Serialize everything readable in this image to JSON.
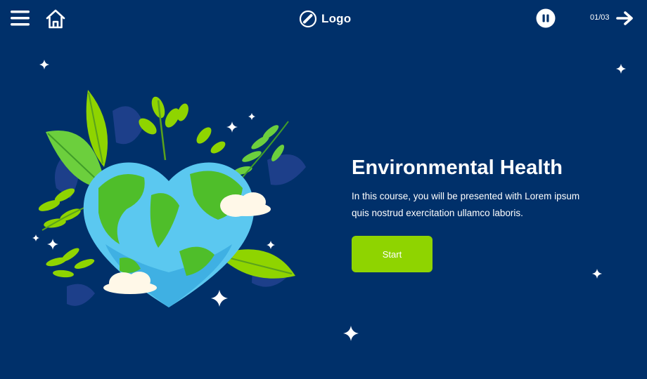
{
  "header": {
    "logo_text": "Logo",
    "page_counter": "01/03"
  },
  "content": {
    "title": "Environmental Health",
    "description": "In this course, you will be presented with Lorem ipsum quis nostrud exercitation ullamco laboris.",
    "start_label": "Start"
  },
  "icons": [
    "hamburger-menu-icon",
    "home-icon",
    "logo-icon",
    "pause-icon",
    "arrow-right-icon",
    "sparkle-icon"
  ],
  "colors": {
    "background": "#00306a",
    "button": "#8fd400",
    "text": "#ffffff"
  }
}
